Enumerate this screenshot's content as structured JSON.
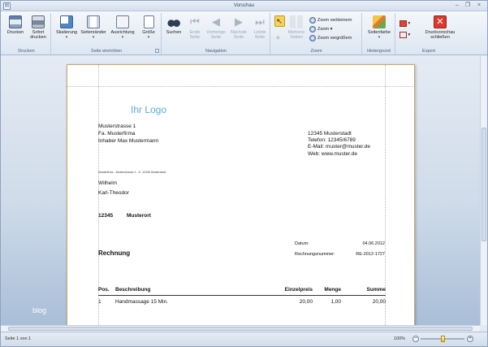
{
  "window": {
    "title": "Vorschau"
  },
  "ribbon": {
    "groups": {
      "drucken": "Drucken",
      "seite": "Seite einrichten",
      "navigation": "Navigation",
      "zoom": "Zoom",
      "hintergrund": "Hintergrund",
      "export": "Export"
    },
    "buttons": {
      "print": "Drucken",
      "quick_print": "Sofort\ndrucken",
      "scale": "Skalierung",
      "margins": "Seitenränder",
      "orientation": "Ausrichtung",
      "size": "Größe",
      "search": "Suchen",
      "first": "Erste\nSeite",
      "prev": "Vorherige\nSeite",
      "next": "Nächste\nSeite",
      "last": "Letzte\nSeite",
      "multi": "Mehrere\nSeiten",
      "zoom_out": "Zoom verkleinern",
      "zoom": "Zoom",
      "zoom_in": "Zoom vergrößern",
      "page_color": "Seitenfarbe",
      "close": "Druckvorschau\nschließen"
    }
  },
  "status": {
    "page": "Seite 1 von 1",
    "zoom": "100%"
  },
  "background_text": "blog",
  "document": {
    "logo": "Ihr Logo",
    "sender_lines": [
      "Musterstrasse 1",
      "Fa. Musterfirma",
      "Inhaber Max Mustermann"
    ],
    "contact_lines": [
      "12345 Musterstadt",
      "Telefon: 12345/6789",
      "E-Mail: muster@muster.de",
      "Web: www.muster.de"
    ],
    "return_address": "Musterfirma - Musterstrasse 1 - D -12345 Musterstadt",
    "recipient_lines": [
      "Wilhelm",
      "Karl-Theodor"
    ],
    "recipient_zip": "12345",
    "recipient_city": "Musterort",
    "date_label": "Datum:",
    "date_value": "04.06.2012",
    "invoice_no_label": "Rechnungsnummer:",
    "invoice_no_value": "RE-2012-1727",
    "heading": "Rechnung",
    "table": {
      "headers": {
        "pos": "Pos.",
        "desc": "Beschreibung",
        "unit": "Einzelpreis",
        "qty": "Menge",
        "sum": "Summe"
      },
      "rows": [
        {
          "pos": "1",
          "desc": "Handmassage 15 Min.",
          "unit": "20,00",
          "qty": "1,00",
          "sum": "20,00"
        }
      ]
    }
  }
}
